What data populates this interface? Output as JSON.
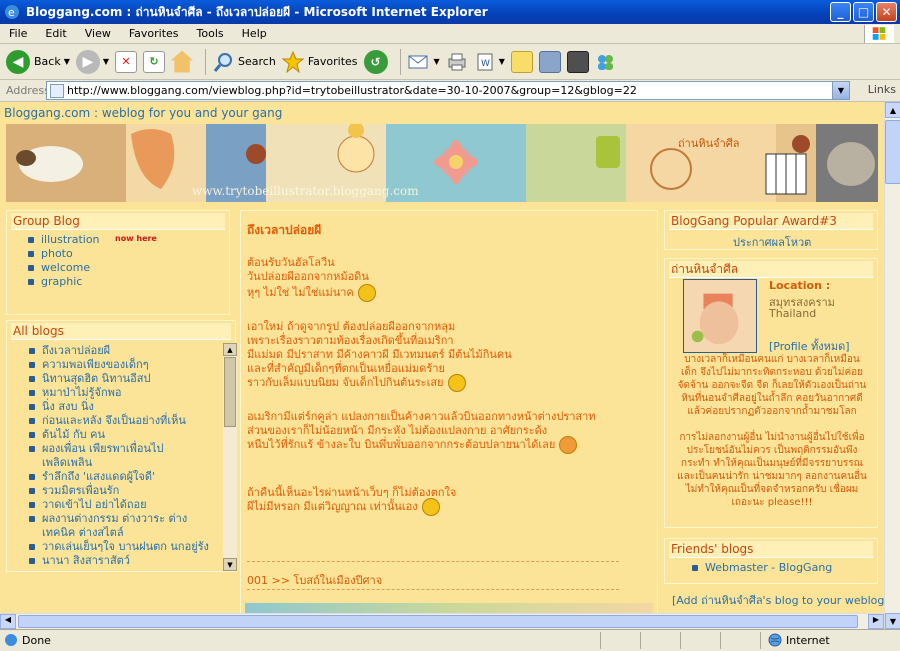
{
  "window": {
    "title": "Bloggang.com : ถ่านหินจำศีล - ถึงเวลาปล่อยผี - Microsoft Internet Explorer",
    "minimize": "_",
    "maximize": "□",
    "close": "✕"
  },
  "menu": [
    "File",
    "Edit",
    "View",
    "Favorites",
    "Tools",
    "Help"
  ],
  "toolbar": {
    "back": "Back",
    "search": "Search",
    "favorites": "Favorites"
  },
  "address": {
    "label": "Address",
    "url": "http://www.bloggang.com/viewblog.php?id=trytobeillustrator&date=30-10-2007&group=12&gblog=22",
    "links": "Links"
  },
  "page": {
    "tagline": "Bloggang.com : weblog for you and your gang",
    "banner_url": "www.trytobeillustrator.bloggang.com",
    "banner_stamp": "ถ่านหินจำศีล",
    "group_blog": {
      "title": "Group Blog",
      "items": [
        "illustration",
        "photo",
        "welcome",
        "graphic"
      ],
      "badge": "now here"
    },
    "all_blogs": {
      "title": "All blogs",
      "items": [
        "ถึงเวลาปล่อยผี",
        "ความพอเพียงของเด็กๆ",
        "นิทานสุดฮิต นิทานอีสป",
        "หมาป่าไม่รู้จักพอ",
        "นิ่ง สงบ นิ่ง",
        "ก่อนและหลัง จึงเป็นอย่างที่เห็น",
        "ต้นไม้ กับ คน",
        "ผองเพื่อน เพียรพาเพื่อนไปเพลิดเพลิน",
        "รำลึกถึง 'แสงแดดผู้ใจดี'",
        "รวมมิตรเพื่อนรัก",
        "วาดเข้าไป อย่าได้ถอย",
        "ผลงานต่างกรรม ต่างวาระ ต่างเทคนิค ต่างสไตล์",
        "วาดเล่นเย็นๆใจ บานฝนตก นกอยู่รัง",
        "นานา สิงสาราสัตว์"
      ]
    },
    "post": {
      "title": "ถึงเวลาปล่อยผี",
      "lines": [
        "ต้อนรับวันฮัลโลวีน",
        "วันปล่อยผีออกจากหม้อดิน",
        "หุๆ ไม่ใช่ ไม่ใช่แม่นาค",
        "เอาใหม่ ถ้าดูจากรูป ต้องปล่อยผีออกจากหลุม",
        "เพราะเรื่องราวตามท้องเรื่องเกิดขึ้นที่อเมริกา",
        "มีแม่มด มีปราสาท มีค้างคาวผี มีเวทมนตร์ มีต้นไม้กินคน",
        "และที่สำคัญมีเด็กๆที่ตกเป็นเหยื่อแม่มดร้าย",
        "ราวกับเล็มแบบนิยม จับเด็กไปกินต้นระเสย",
        "อเมริกามีแต่ร์กคูล่า แปลงกายเป็นค้างคาวแล้วบินออกทางหน้าต่างปราสาท",
        "ส่วนของเราก็ไม่น้อยหน้า มีกระหัง ไม่ต้องแปลงกาย อาศัยกระด้ง",
        "หนีบไว้ที่รักแร้ ข้างละใบ บินพึ่บพั่บออกจากกระต้อบปลายนาได้เลย",
        "ถ้าคืนนี้เห็นอะไรผ่านหน้าเว็บๆ ก็ไม่ต้องตกใจ",
        "ผีไม่มีหรอก มีแต่วิญญาณ เท่านั้นเอง"
      ],
      "comment": "001 >> โบสถ์ในเมืองปีศาจ"
    },
    "right": {
      "award_title": "BlogGang Popular Award#3",
      "award_link": "ประกาศผลโหวต",
      "profile_title": "ถ่านหินจำศีล",
      "location_label": "Location :",
      "location_1": "สมุทรสงคราม",
      "location_2": "Thailand",
      "profile_link": "[Profile ทั้งหมด]",
      "bio_lines": [
        "บางเวลาก็เหมือนคนแก่ บางเวลาก็เหมือน",
        "เด็ก จึงไปไม่มากระทิตกระหอบ ด้วยไม่ค่อย",
        "จัดจ้าน ออกจะจืด จืด ก็เลยให้ตัวเองเป็นถ่าน",
        "หินที่นอนจำศีลอยู่ในถ้ำลึก คอยวันอากาศดี",
        "แล้วค่อยปรากฏตัวออกจากถ้ำมาชมโลก",
        "",
        "การไม่ลอกงานผู้อื่น ไม่นำงานผู้อื่นไปใช้เพื่อ",
        "ประโยชน์อันไม่ควร เป็นพฤติกรรมอันพึง",
        "กระทำ ทำให้คุณเป็นมนุษย์ที่มีจรรยาบรรณ",
        "และเป็นคนน่ารัก น่าชมมากๆ ลอกงานคนอื่น",
        "ไม่ทำให้คุณเป็นที่จดจำหรอกครับ เชื่อผม",
        "เถอะนะ please!!!"
      ],
      "friends_title": "Friends' blogs",
      "friend_1": "Webmaster - BlogGang",
      "add_link": "[Add ถ่านหินจำศีล's blog to your weblog]"
    }
  },
  "status": {
    "done": "Done",
    "zone": "Internet"
  }
}
